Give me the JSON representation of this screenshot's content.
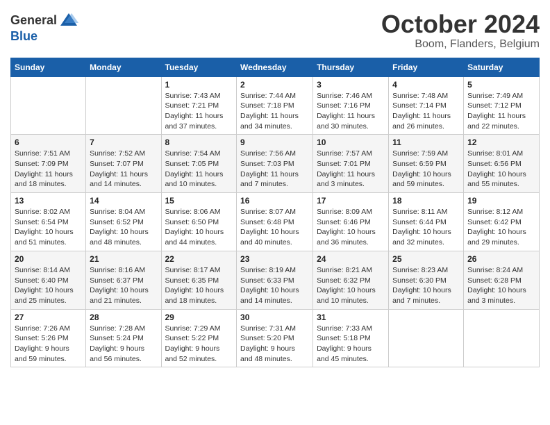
{
  "header": {
    "logo_general": "General",
    "logo_blue": "Blue",
    "month_title": "October 2024",
    "location": "Boom, Flanders, Belgium"
  },
  "weekdays": [
    "Sunday",
    "Monday",
    "Tuesday",
    "Wednesday",
    "Thursday",
    "Friday",
    "Saturday"
  ],
  "weeks": [
    [
      {
        "day": "",
        "info": ""
      },
      {
        "day": "",
        "info": ""
      },
      {
        "day": "1",
        "info": "Sunrise: 7:43 AM\nSunset: 7:21 PM\nDaylight: 11 hours and 37 minutes."
      },
      {
        "day": "2",
        "info": "Sunrise: 7:44 AM\nSunset: 7:18 PM\nDaylight: 11 hours and 34 minutes."
      },
      {
        "day": "3",
        "info": "Sunrise: 7:46 AM\nSunset: 7:16 PM\nDaylight: 11 hours and 30 minutes."
      },
      {
        "day": "4",
        "info": "Sunrise: 7:48 AM\nSunset: 7:14 PM\nDaylight: 11 hours and 26 minutes."
      },
      {
        "day": "5",
        "info": "Sunrise: 7:49 AM\nSunset: 7:12 PM\nDaylight: 11 hours and 22 minutes."
      }
    ],
    [
      {
        "day": "6",
        "info": "Sunrise: 7:51 AM\nSunset: 7:09 PM\nDaylight: 11 hours and 18 minutes."
      },
      {
        "day": "7",
        "info": "Sunrise: 7:52 AM\nSunset: 7:07 PM\nDaylight: 11 hours and 14 minutes."
      },
      {
        "day": "8",
        "info": "Sunrise: 7:54 AM\nSunset: 7:05 PM\nDaylight: 11 hours and 10 minutes."
      },
      {
        "day": "9",
        "info": "Sunrise: 7:56 AM\nSunset: 7:03 PM\nDaylight: 11 hours and 7 minutes."
      },
      {
        "day": "10",
        "info": "Sunrise: 7:57 AM\nSunset: 7:01 PM\nDaylight: 11 hours and 3 minutes."
      },
      {
        "day": "11",
        "info": "Sunrise: 7:59 AM\nSunset: 6:59 PM\nDaylight: 10 hours and 59 minutes."
      },
      {
        "day": "12",
        "info": "Sunrise: 8:01 AM\nSunset: 6:56 PM\nDaylight: 10 hours and 55 minutes."
      }
    ],
    [
      {
        "day": "13",
        "info": "Sunrise: 8:02 AM\nSunset: 6:54 PM\nDaylight: 10 hours and 51 minutes."
      },
      {
        "day": "14",
        "info": "Sunrise: 8:04 AM\nSunset: 6:52 PM\nDaylight: 10 hours and 48 minutes."
      },
      {
        "day": "15",
        "info": "Sunrise: 8:06 AM\nSunset: 6:50 PM\nDaylight: 10 hours and 44 minutes."
      },
      {
        "day": "16",
        "info": "Sunrise: 8:07 AM\nSunset: 6:48 PM\nDaylight: 10 hours and 40 minutes."
      },
      {
        "day": "17",
        "info": "Sunrise: 8:09 AM\nSunset: 6:46 PM\nDaylight: 10 hours and 36 minutes."
      },
      {
        "day": "18",
        "info": "Sunrise: 8:11 AM\nSunset: 6:44 PM\nDaylight: 10 hours and 32 minutes."
      },
      {
        "day": "19",
        "info": "Sunrise: 8:12 AM\nSunset: 6:42 PM\nDaylight: 10 hours and 29 minutes."
      }
    ],
    [
      {
        "day": "20",
        "info": "Sunrise: 8:14 AM\nSunset: 6:40 PM\nDaylight: 10 hours and 25 minutes."
      },
      {
        "day": "21",
        "info": "Sunrise: 8:16 AM\nSunset: 6:37 PM\nDaylight: 10 hours and 21 minutes."
      },
      {
        "day": "22",
        "info": "Sunrise: 8:17 AM\nSunset: 6:35 PM\nDaylight: 10 hours and 18 minutes."
      },
      {
        "day": "23",
        "info": "Sunrise: 8:19 AM\nSunset: 6:33 PM\nDaylight: 10 hours and 14 minutes."
      },
      {
        "day": "24",
        "info": "Sunrise: 8:21 AM\nSunset: 6:32 PM\nDaylight: 10 hours and 10 minutes."
      },
      {
        "day": "25",
        "info": "Sunrise: 8:23 AM\nSunset: 6:30 PM\nDaylight: 10 hours and 7 minutes."
      },
      {
        "day": "26",
        "info": "Sunrise: 8:24 AM\nSunset: 6:28 PM\nDaylight: 10 hours and 3 minutes."
      }
    ],
    [
      {
        "day": "27",
        "info": "Sunrise: 7:26 AM\nSunset: 5:26 PM\nDaylight: 9 hours and 59 minutes."
      },
      {
        "day": "28",
        "info": "Sunrise: 7:28 AM\nSunset: 5:24 PM\nDaylight: 9 hours and 56 minutes."
      },
      {
        "day": "29",
        "info": "Sunrise: 7:29 AM\nSunset: 5:22 PM\nDaylight: 9 hours and 52 minutes."
      },
      {
        "day": "30",
        "info": "Sunrise: 7:31 AM\nSunset: 5:20 PM\nDaylight: 9 hours and 48 minutes."
      },
      {
        "day": "31",
        "info": "Sunrise: 7:33 AM\nSunset: 5:18 PM\nDaylight: 9 hours and 45 minutes."
      },
      {
        "day": "",
        "info": ""
      },
      {
        "day": "",
        "info": ""
      }
    ]
  ]
}
